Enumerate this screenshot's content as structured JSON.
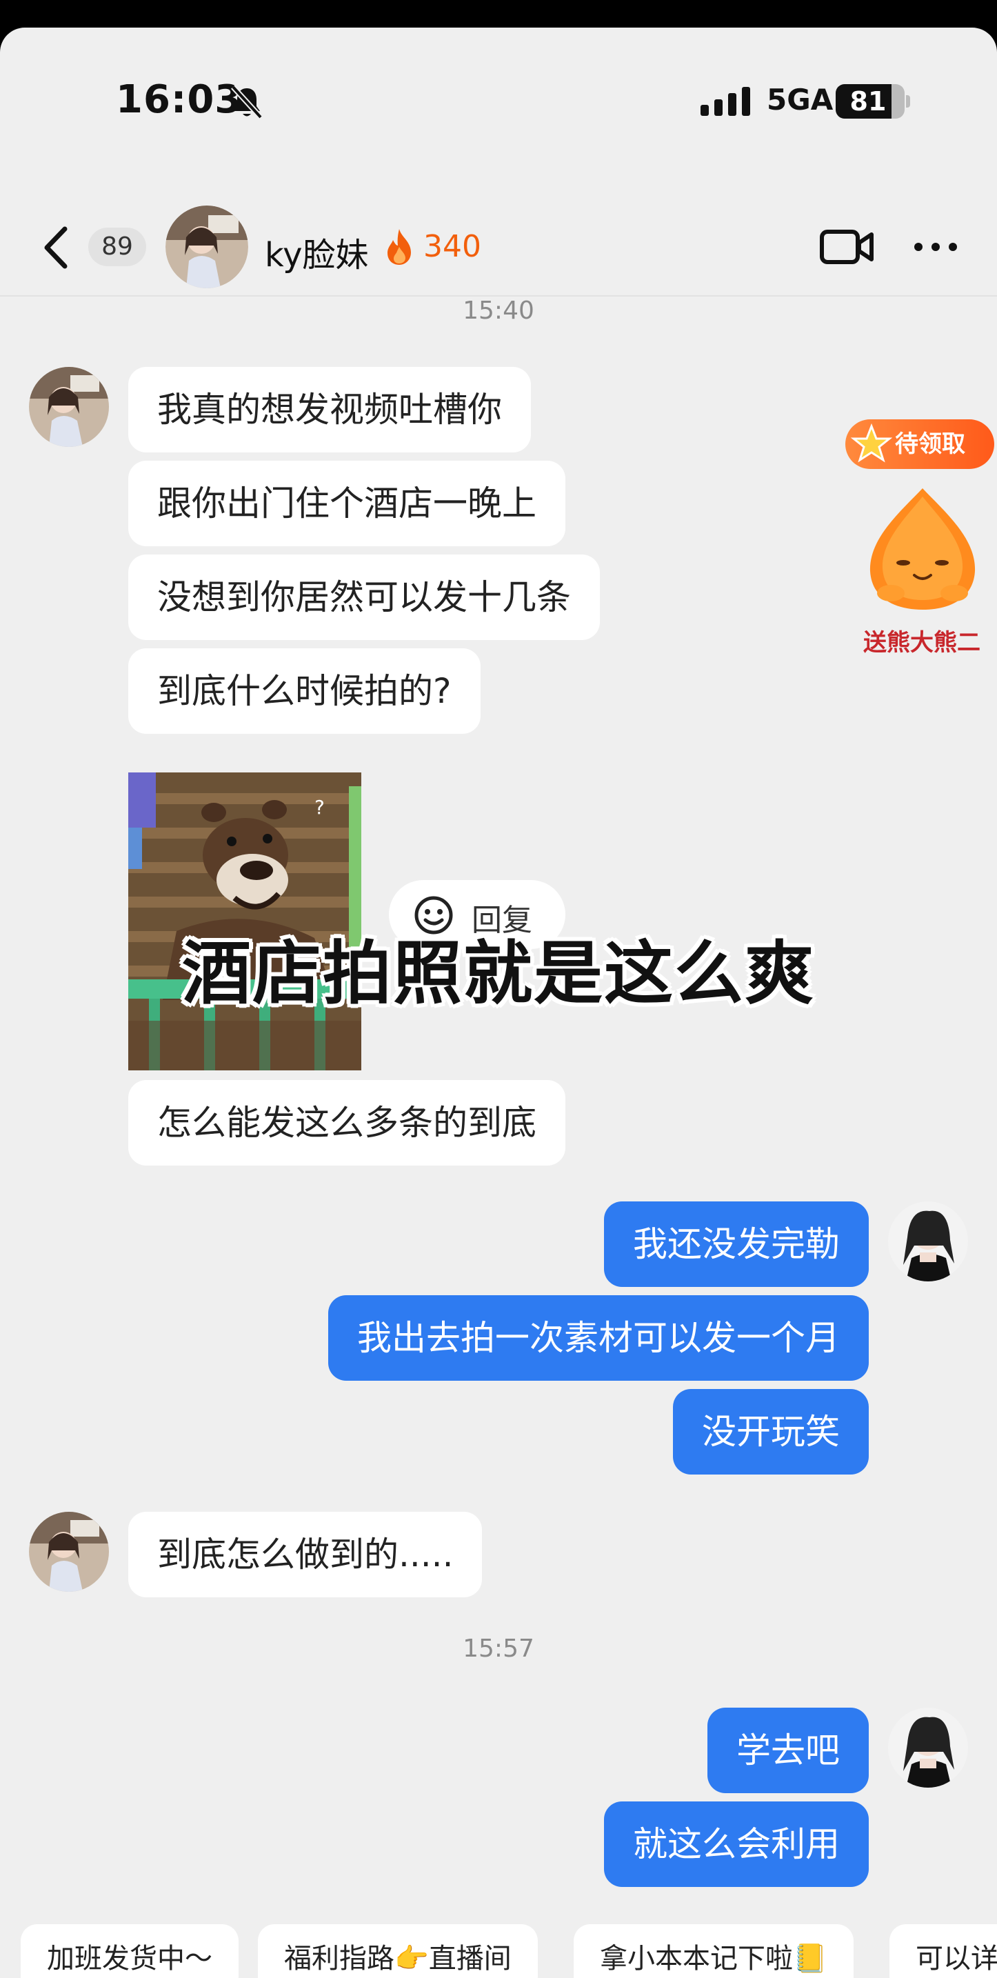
{
  "status_bar": {
    "time": "16:03",
    "network": "5GA",
    "battery": "81",
    "battery_level": 0.81
  },
  "header": {
    "unread_count": "89",
    "contact_name": "ky脸妹",
    "streak_count": "340"
  },
  "messages": {
    "timestamp_1": "15:40",
    "incoming_1": [
      "我真的想发视频吐槽你",
      "跟你出门住个酒店一晚上",
      "没想到你居然可以发十几条",
      "到底什么时候拍的?"
    ],
    "reply_chip_label": "回复",
    "incoming_2": "怎么能发这么多条的到底",
    "outgoing_1": [
      "我还没发完勒",
      "我出去拍一次素材可以发一个月",
      "没开玩笑"
    ],
    "incoming_3": "到底怎么做到的.....",
    "timestamp_2": "15:57",
    "outgoing_2": [
      "学去吧",
      "就这么会利用"
    ]
  },
  "overlay_caption": "酒店拍照就是这么爽",
  "promo": {
    "badge": "待领取",
    "caption": "送熊大熊二"
  },
  "quick_replies": [
    "加班发货中～",
    "福利指路👉直播间",
    "拿小本本记下啦📒",
    "可以详"
  ],
  "colors": {
    "outgoing_bubble": "#2e7bf1",
    "incoming_bubble": "#ffffff",
    "streak": "#f25f0c"
  },
  "icons": [
    "mute-icon",
    "signal-icon",
    "back-icon",
    "flame-icon",
    "video-call-icon",
    "more-icon",
    "emoji-icon",
    "star-icon"
  ]
}
